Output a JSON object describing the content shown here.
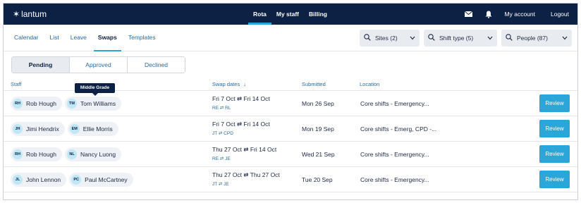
{
  "brand": {
    "name": "lantum"
  },
  "topnav": {
    "links": [
      {
        "label": "Rota",
        "active": true
      },
      {
        "label": "My staff",
        "active": false
      },
      {
        "label": "Billing",
        "active": false
      }
    ],
    "icons": [
      "mail-icon",
      "bell-icon"
    ],
    "account_label": "My account",
    "logout_label": "Logout"
  },
  "subnav": {
    "tabs": [
      {
        "label": "Calendar"
      },
      {
        "label": "List"
      },
      {
        "label": "Leave"
      },
      {
        "label": "Swaps"
      },
      {
        "label": "Templates"
      }
    ],
    "filters": [
      {
        "label": "Sites (2)"
      },
      {
        "label": "Shift type (5)"
      },
      {
        "label": "People (87)"
      }
    ]
  },
  "segment": {
    "options": [
      "Pending",
      "Approved",
      "Declined"
    ],
    "selected": "Pending"
  },
  "table": {
    "headers": {
      "staff": "Staff",
      "swap_dates": "Swap dates",
      "sort_icon": "↓",
      "submitted": "Submitted",
      "location": "Location"
    },
    "rows": [
      {
        "staff_a": {
          "initials": "RH",
          "name": "Rob Hough"
        },
        "staff_b": {
          "initials": "TM",
          "name": "Tom Williams"
        },
        "dates": "Fri 7 Oct ⇄ Fri 14 Oct",
        "codes": "RE ⇄ RL",
        "submitted": "Mon 26 Sep",
        "location": "Core shifts - Emergency...",
        "action": "Review"
      },
      {
        "staff_a": {
          "initials": "JH",
          "name": "Jimi Hendrix"
        },
        "staff_b": {
          "initials": "EM",
          "name": "Ellie Morris"
        },
        "dates": "Fri 7 Oct ⇄ Fri 14 Oct",
        "codes": "JT ⇄ CPD",
        "submitted": "Mon 19 Sep",
        "location": "Core shifts - Emerg, CPD -...",
        "action": "Review"
      },
      {
        "staff_a": {
          "initials": "RH",
          "name": "Rob Hough"
        },
        "staff_b": {
          "initials": "NL",
          "name": "Nancy Luong"
        },
        "dates": "Thu 27 Oct ⇄ Fri 14 Oct",
        "codes": "RE ⇄ JE",
        "submitted": "Wed 21 Sep",
        "location": "Core shifts - Emergency...",
        "action": "Review"
      },
      {
        "staff_a": {
          "initials": "JL",
          "name": "John Lennon"
        },
        "staff_b": {
          "initials": "PC",
          "name": "Paul McCartney"
        },
        "dates": "Thu 27 Oct ⇄ Thu 27 Oct",
        "codes": "JT ⇄ JE",
        "submitted": "Tue 20 Sep",
        "location": "Core shifts - Emergency...",
        "action": "Review"
      }
    ]
  },
  "tooltip": {
    "text": "Middle Grade"
  },
  "colors": {
    "navy": "#0d2144",
    "accent": "#2aa6d8",
    "link": "#2a6aa0"
  }
}
